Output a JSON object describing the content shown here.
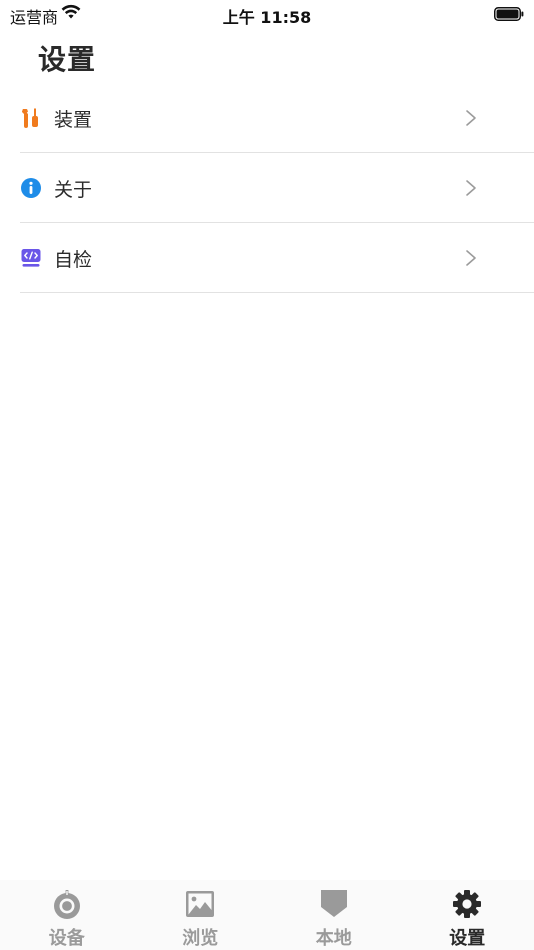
{
  "status_bar": {
    "carrier": "运营商",
    "time": "上午 11:58",
    "icons": [
      "wifi-icon",
      "battery-icon"
    ]
  },
  "page": {
    "title": "设置"
  },
  "settings": {
    "items": [
      {
        "label": "装置",
        "icon": "wrench-screwdriver-icon"
      },
      {
        "label": "关于",
        "icon": "info-icon"
      },
      {
        "label": "自检",
        "icon": "code-icon"
      }
    ]
  },
  "tab_bar": {
    "tabs": [
      {
        "label": "设备",
        "icon": "device-icon",
        "active": false
      },
      {
        "label": "浏览",
        "icon": "image-icon",
        "active": false
      },
      {
        "label": "本地",
        "icon": "bookmark-icon",
        "active": false
      },
      {
        "label": "设置",
        "icon": "gear-icon",
        "active": true
      }
    ]
  },
  "colors": {
    "icon_orange": "#f07b1e",
    "icon_blue": "#1e8ce8",
    "icon_purple": "#6a56e8",
    "tab_inactive": "#9a9a9a",
    "tab_active": "#2a2a2a",
    "divider": "#e2e2e2"
  }
}
